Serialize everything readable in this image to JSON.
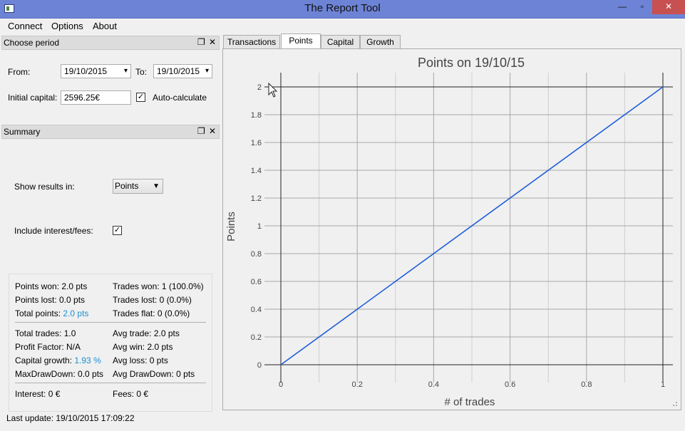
{
  "window": {
    "title": "The Report Tool"
  },
  "menu": [
    "Connect",
    "Options",
    "About"
  ],
  "choose_period": {
    "title": "Choose period",
    "from_label": "From:",
    "from_value": "19/10/2015",
    "to_label": "To:",
    "to_value": "19/10/2015",
    "capital_label": "Initial capital:",
    "capital_value": "2596.25€",
    "auto_label": "Auto-calculate",
    "auto_checked": true
  },
  "summary": {
    "title": "Summary",
    "show_results_label": "Show results in:",
    "show_results_value": "Points",
    "include_label": "Include interest/fees:",
    "include_checked": true,
    "stats": {
      "points_won": "Points won: 2.0 pts",
      "trades_won": "Trades won: 1 (100.0%)",
      "points_lost": "Points lost: 0.0 pts",
      "trades_lost": "Trades lost: 0 (0.0%)",
      "total_points_label": "Total points: ",
      "total_points_value": "2.0 pts",
      "trades_flat": "Trades flat: 0 (0.0%)",
      "total_trades": "Total trades: 1.0",
      "avg_trade": "Avg trade: 2.0 pts",
      "profit_factor": "Profit Factor: N/A",
      "avg_win": "Avg win: 2.0 pts",
      "capital_growth_label": "Capital growth: ",
      "capital_growth_value": "1.93 %",
      "avg_loss": "Avg loss: 0 pts",
      "maxdrawdown": "MaxDrawDown: 0.0 pts",
      "avg_drawdown": "Avg DrawDown: 0 pts",
      "interest": "Interest: 0 €",
      "fees": "Fees: 0 €"
    }
  },
  "status": {
    "last_update": "Last update: 19/10/2015 17:09:22"
  },
  "tabs": [
    "Transactions",
    "Points",
    "Capital",
    "Growth"
  ],
  "active_tab": "Points",
  "colors": {
    "line": "#1f5fd8",
    "highlight": "#1e90d0",
    "titlebar": "#6d83d6",
    "close": "#c75050"
  },
  "chart_data": {
    "type": "line",
    "title": "Points on 19/10/15",
    "xlabel": "# of trades",
    "ylabel": "Points",
    "xlim": [
      0,
      1
    ],
    "ylim": [
      0,
      2
    ],
    "x_ticks": [
      "0",
      "0.2",
      "0.4",
      "0.6",
      "0.8",
      "1"
    ],
    "y_ticks": [
      "0",
      "0.2",
      "0.4",
      "0.6",
      "0.8",
      "1",
      "1.2",
      "1.4",
      "1.6",
      "1.8",
      "2"
    ],
    "grid": true,
    "series": [
      {
        "x": [
          0,
          1
        ],
        "y": [
          0,
          2
        ]
      }
    ]
  }
}
